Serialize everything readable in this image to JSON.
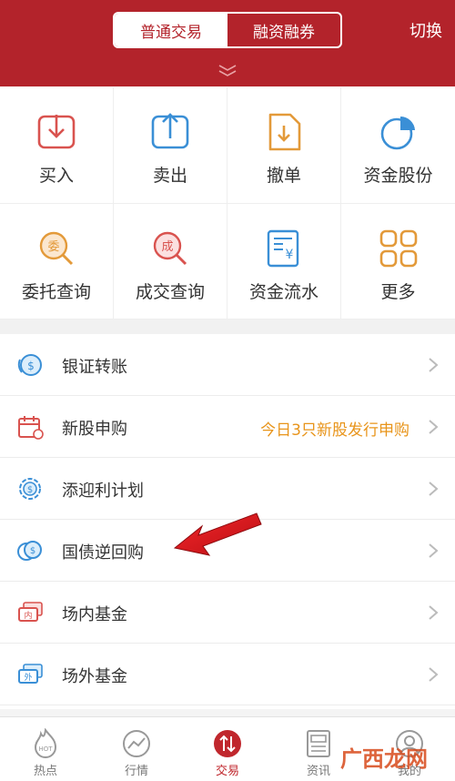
{
  "header": {
    "tabs": [
      {
        "label": "普通交易",
        "active": true
      },
      {
        "label": "融资融券",
        "active": false
      }
    ],
    "switch_label": "切换",
    "background_color": "#b3232b"
  },
  "grid": [
    {
      "label": "买入",
      "icon": "buy-icon"
    },
    {
      "label": "卖出",
      "icon": "sell-icon"
    },
    {
      "label": "撤单",
      "icon": "cancel-order-icon"
    },
    {
      "label": "资金股份",
      "icon": "funds-shares-icon"
    },
    {
      "label": "委托查询",
      "icon": "order-query-icon",
      "glyph": "委"
    },
    {
      "label": "成交查询",
      "icon": "deal-query-icon",
      "glyph": "成"
    },
    {
      "label": "资金流水",
      "icon": "fund-flow-icon",
      "glyph": "¥"
    },
    {
      "label": "更多",
      "icon": "more-icon"
    }
  ],
  "list": [
    {
      "label": "银证转账",
      "value": "",
      "icon": "bank-transfer-icon"
    },
    {
      "label": "新股申购",
      "value": "今日3只新股发行申购",
      "icon": "ipo-calendar-icon"
    },
    {
      "label": "添迎利计划",
      "value": "",
      "icon": "plan-coin-icon"
    },
    {
      "label": "国债逆回购",
      "value": "",
      "icon": "bond-repo-icon"
    },
    {
      "label": "场内基金",
      "value": "",
      "icon": "onsite-fund-icon"
    },
    {
      "label": "场外基金",
      "value": "",
      "icon": "offsite-fund-icon"
    }
  ],
  "tabbar": [
    {
      "label": "热点",
      "icon": "hot-icon",
      "active": false,
      "icon_text": "HOT"
    },
    {
      "label": "行情",
      "icon": "market-icon",
      "active": false
    },
    {
      "label": "交易",
      "icon": "trade-icon",
      "active": true
    },
    {
      "label": "资讯",
      "icon": "news-icon",
      "active": false
    },
    {
      "label": "我的",
      "icon": "profile-icon",
      "active": false
    }
  ],
  "watermark": "广西龙网",
  "colors": {
    "accent": "#c0272d",
    "highlight": "#e8941a",
    "icon_blue": "#3a8fd6",
    "icon_orange": "#e39a3a"
  }
}
